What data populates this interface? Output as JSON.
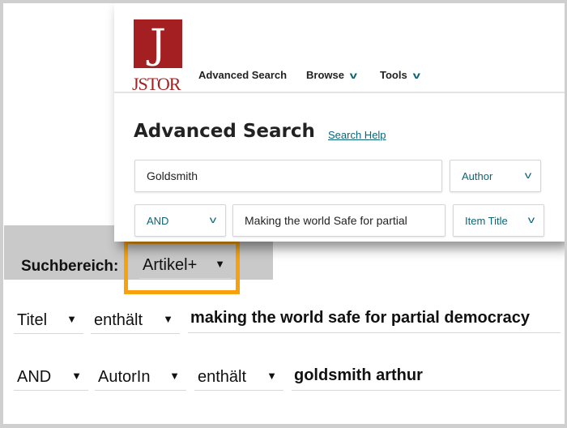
{
  "jstor": {
    "logo_text": "JSTOR",
    "nav": [
      {
        "label": "Advanced Search"
      },
      {
        "label": "Browse"
      },
      {
        "label": "Tools"
      }
    ],
    "title": "Advanced Search",
    "help_link": "Search Help",
    "row1": {
      "value": "Goldsmith",
      "field": "Author"
    },
    "row2": {
      "operator": "AND",
      "value": "Making the world Safe for partial",
      "field": "Item Title"
    },
    "accent": "#0c6476",
    "brand": "#a31f22"
  },
  "local": {
    "scope_label": "Suchbereich:",
    "scope_value": "Artikel+",
    "highlight_color": "#f7a10e",
    "row1": {
      "field": "Titel",
      "condition": "enthält",
      "value": "making the world safe for partial democracy"
    },
    "row2": {
      "operator": "AND",
      "field": "AutorIn",
      "condition": "enthält",
      "value": "goldsmith arthur"
    }
  }
}
